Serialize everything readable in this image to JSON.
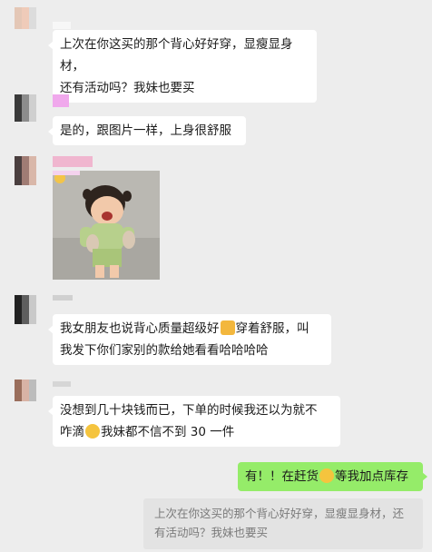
{
  "messages": [
    {
      "text_line1": "上次在你这买的那个背心好好穿，显瘦显身材，",
      "text_line2": "还有活动吗？我妹也要买"
    },
    {
      "text_line1": "是的，跟图片一样，上身很舒服"
    },
    {
      "image": "photo-of-laughing-child"
    },
    {
      "text_line1_a": "我女朋友也说背心质量超级好",
      "text_line1_b": "穿着舒服，叫",
      "text_line2": "我发下你们家别的款给她看看哈哈哈哈"
    },
    {
      "text_line1": "没想到几十块钱而已，下单的时候我还以为就不",
      "text_line2_a": "咋滴",
      "text_line2_b": "我妹都不信不到 30 一件"
    }
  ],
  "reply": {
    "text_a": "有！！在赶货",
    "text_b": "等我加点库存"
  },
  "quote": {
    "line1": "上次在你这买的那个背心好好穿，显瘦显身材，还",
    "line2": "有活动吗？我妹也要买"
  },
  "colors": {
    "background": "#ededed",
    "my_bubble": "#95ec69",
    "their_bubble": "#ffffff"
  }
}
